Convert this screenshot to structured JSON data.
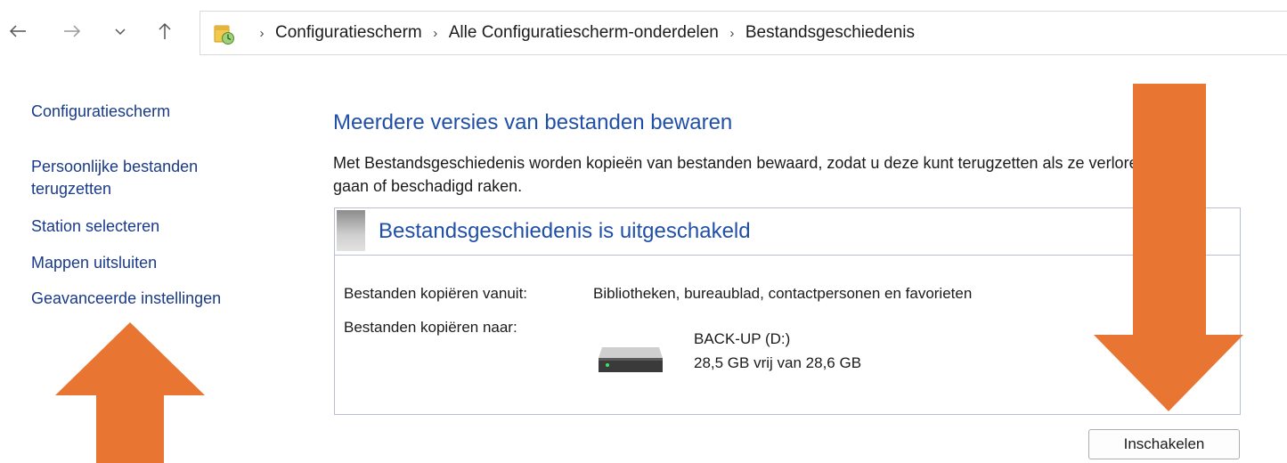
{
  "nav": {
    "back_icon": "arrow-left-icon",
    "forward_icon": "arrow-right-icon",
    "recent_icon": "chevron-down-icon",
    "up_icon": "arrow-up-icon"
  },
  "address": {
    "icon": "control-panel-icon",
    "separator": "›",
    "crumbs": [
      "Configuratiescherm",
      "Alle Configuratiescherm-onderdelen",
      "Bestandsgeschiedenis"
    ]
  },
  "sidebar": {
    "home": "Configuratiescherm",
    "tasks": [
      "Persoonlijke bestanden terugzetten",
      "Station selecteren",
      "Mappen uitsluiten",
      "Geavanceerde instellingen"
    ]
  },
  "main": {
    "title": "Meerdere versies van bestanden bewaren",
    "description": "Met Bestandsgeschiedenis worden kopieën van bestanden bewaard, zodat u deze kunt terugzetten als ze verloren gaan of beschadigd raken.",
    "status": "Bestandsgeschiedenis is uitgeschakeld",
    "copy_from_label": "Bestanden kopiëren vanuit:",
    "copy_from_value": "Bibliotheken, bureaublad, contactpersonen en favorieten",
    "copy_to_label": "Bestanden kopiëren naar:",
    "drive_name": "BACK-UP (D:)",
    "drive_space": "28,5 GB vrij van 28,6 GB",
    "enable_button": "Inschakelen"
  },
  "colors": {
    "link": "#1a3a8a",
    "heading": "#1f4fa8",
    "annotation_arrow": "#e87532"
  },
  "annotations": {
    "up_arrow": "arrow-up-annotation",
    "down_arrow": "arrow-down-annotation"
  }
}
